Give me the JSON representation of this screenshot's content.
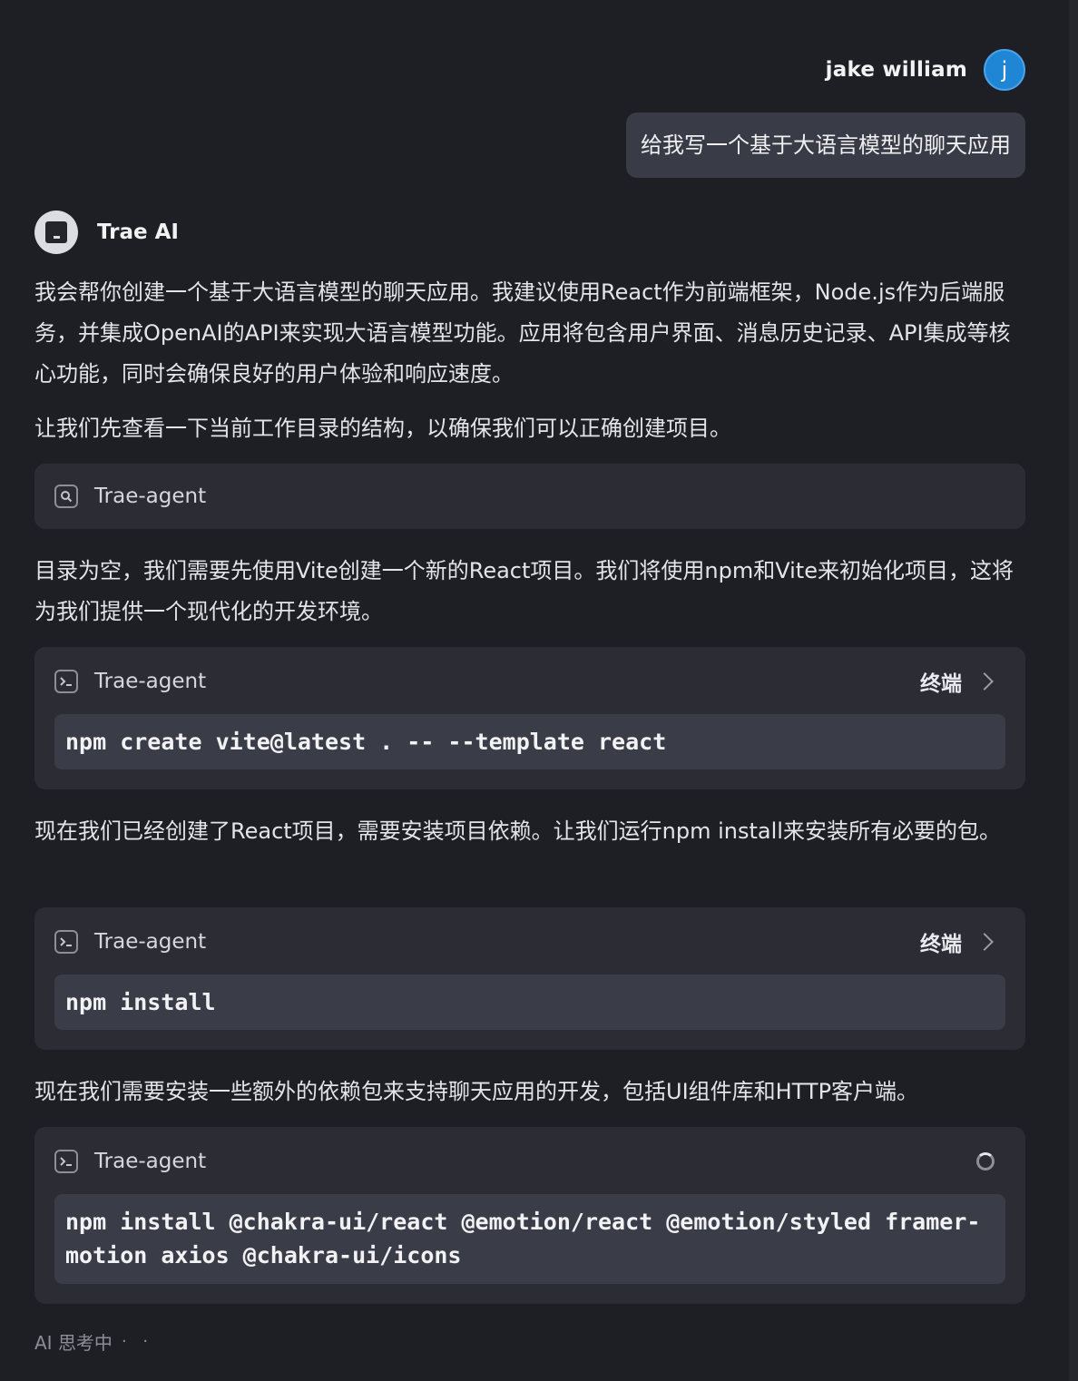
{
  "user": {
    "name": "jake william",
    "avatar_letter": "j",
    "message": "给我写一个基于大语言模型的聊天应用"
  },
  "assistant": {
    "name": "Trae AI"
  },
  "messages": {
    "intro": "我会帮你创建一个基于大语言模型的聊天应用。我建议使用React作为前端框架，Node.js作为后端服务，并集成OpenAI的API来实现大语言模型功能。应用将包含用户界面、消息历史记录、API集成等核心功能，同时会确保良好的用户体验和响应速度。",
    "check_dir": "让我们先查看一下当前工作目录的结构，以确保我们可以正确创建项目。",
    "create_project": "目录为空，我们需要先使用Vite创建一个新的React项目。我们将使用npm和Vite来初始化项目，这将为我们提供一个现代化的开发环境。",
    "install_deps": "现在我们已经创建了React项目，需要安装项目依赖。让我们运行npm install来安装所有必要的包。",
    "install_extra": "现在我们需要安装一些额外的依赖包来支持聊天应用的开发，包括UI组件库和HTTP客户端。"
  },
  "tools": {
    "search": {
      "label": "Trae-agent",
      "icon": "search-icon"
    },
    "vite": {
      "label": "Trae-agent",
      "terminal": "终端",
      "command": "npm create vite@latest . -- --template react",
      "icon": "terminal-icon"
    },
    "install": {
      "label": "Trae-agent",
      "terminal": "终端",
      "command": "npm install",
      "icon": "terminal-icon"
    },
    "extra": {
      "label": "Trae-agent",
      "command": "npm install @chakra-ui/react @emotion/react @emotion/styled framer-motion axios @chakra-ui/icons",
      "icon": "terminal-icon",
      "status": "running"
    }
  },
  "status": {
    "thinking": "AI 思考中",
    "dots": "· ·"
  },
  "colors": {
    "background": "#1e1f24",
    "card": "#2b2c34",
    "code": "#3a3c47",
    "user_bubble": "#393b46",
    "avatar_blue": "#1f86d6"
  }
}
